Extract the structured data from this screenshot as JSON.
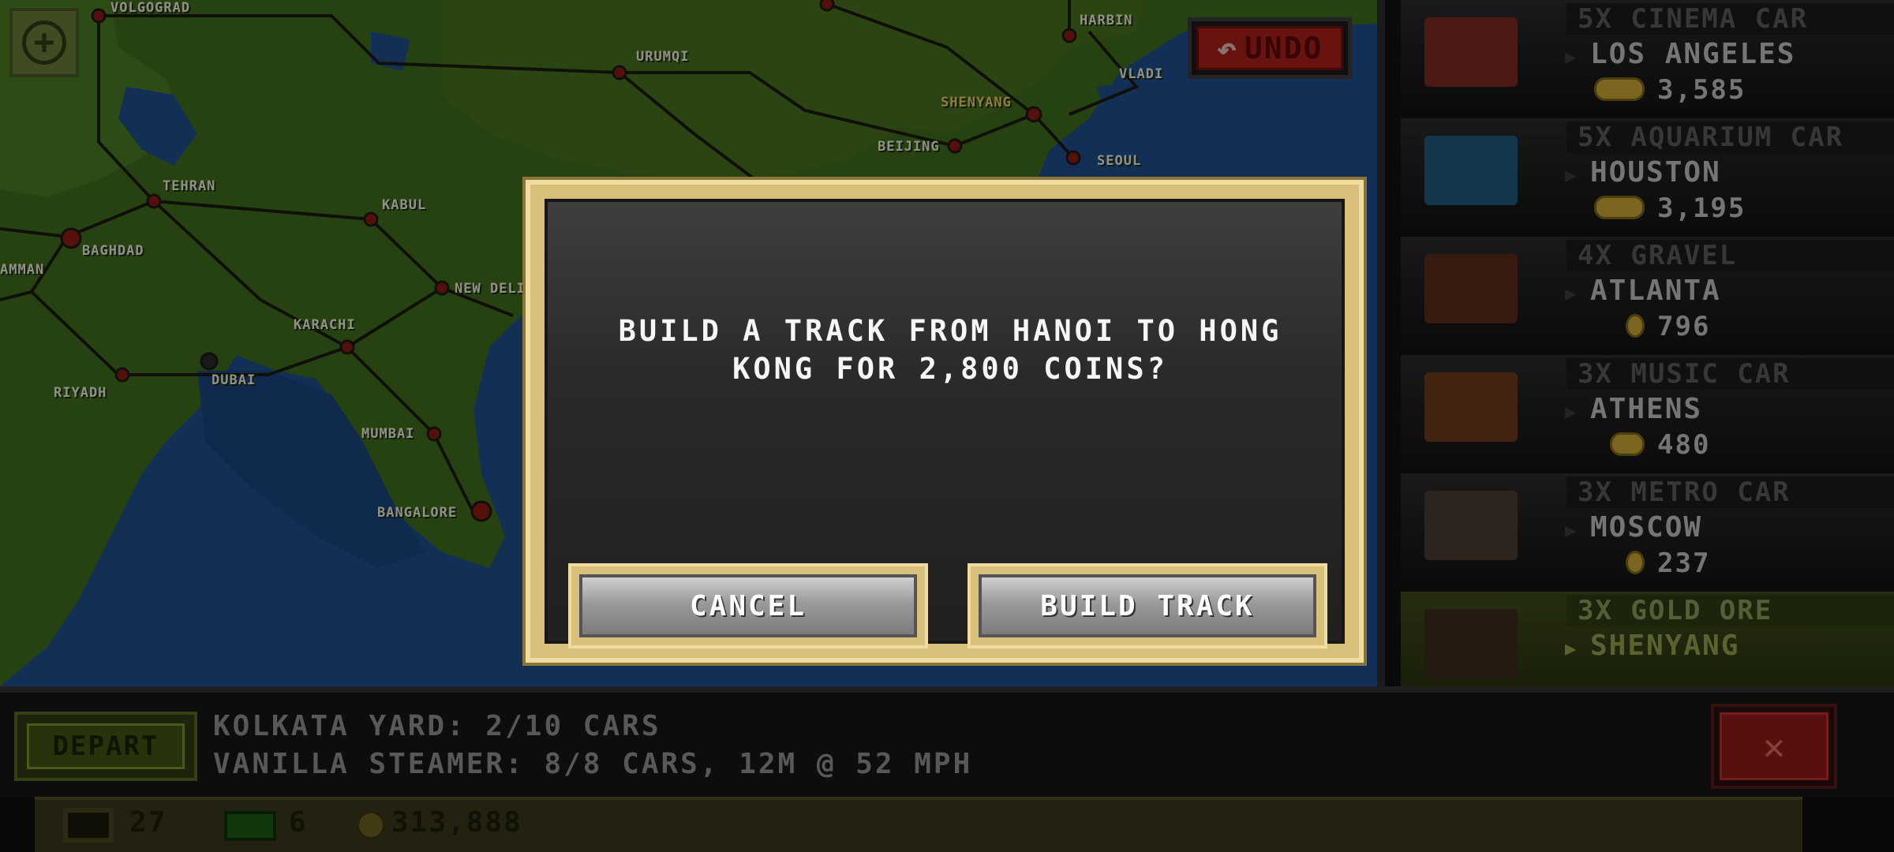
{
  "map": {
    "zoom_icon": "plus-in-circle-icon",
    "undo_label": "UNDO",
    "undo_icon": "curved-arrow-left-icon",
    "cities": [
      {
        "name": "VOLGOGRAD",
        "highlight": false
      },
      {
        "name": "HARBIN",
        "highlight": false
      },
      {
        "name": "URUMQI",
        "highlight": false
      },
      {
        "name": "VLADI",
        "highlight": false
      },
      {
        "name": "SHENYANG",
        "highlight": true
      },
      {
        "name": "BEIJING",
        "highlight": false
      },
      {
        "name": "SEOUL",
        "highlight": false
      },
      {
        "name": "TEHRAN",
        "highlight": false
      },
      {
        "name": "KABUL",
        "highlight": false
      },
      {
        "name": "BAGHDAD",
        "highlight": false
      },
      {
        "name": "AMMAN",
        "highlight": false
      },
      {
        "name": "NEW DELI",
        "highlight": false
      },
      {
        "name": "KARACHI",
        "highlight": false
      },
      {
        "name": "RIYADH",
        "highlight": false
      },
      {
        "name": "DUBAI",
        "highlight": false
      },
      {
        "name": "MUMBAI",
        "highlight": false
      },
      {
        "name": "BANGALORE",
        "highlight": false
      }
    ]
  },
  "route_list": [
    {
      "cargo": "5X CINEMA CAR",
      "destination": "LOS ANGELES",
      "payout": "3,585",
      "coin_icon": "coin-stack-icon",
      "thumb_color": "#7a2a22",
      "selected": false
    },
    {
      "cargo": "5X AQUARIUM CAR",
      "destination": "HOUSTON",
      "payout": "3,195",
      "coin_icon": "coin-stack-icon",
      "thumb_color": "#1f5a78",
      "selected": false
    },
    {
      "cargo": "4X GRAVEL",
      "destination": "ATLANTA",
      "payout": "796",
      "coin_icon": "coin-icon",
      "thumb_color": "#5a2a1a",
      "selected": false
    },
    {
      "cargo": "3X MUSIC CAR",
      "destination": "ATHENS",
      "payout": "480",
      "coin_icon": "coin-stack-icon",
      "thumb_color": "#6a3a1a",
      "selected": false
    },
    {
      "cargo": "3X METRO CAR",
      "destination": "MOSCOW",
      "payout": "237",
      "coin_icon": "coin-icon",
      "thumb_color": "#4a3a34",
      "selected": false
    },
    {
      "cargo": "3X GOLD ORE",
      "destination": "SHENYANG",
      "payout": "",
      "coin_icon": "coin-stack-icon",
      "thumb_color": "#3a2a1a",
      "selected": true
    }
  ],
  "bottom_bar": {
    "depart_label": "DEPART",
    "yard_info": "KOLKATA YARD: 2/10 CARS",
    "train_info": "VANILLA STEAMER: 8/8 CARS, 12M @ 52 MPH",
    "close_label": "✕"
  },
  "status_bar": {
    "depots": "27",
    "cash": "6",
    "coins": "313,888"
  },
  "dialog": {
    "message_line1": "BUILD A TRACK FROM HANOI TO HONG",
    "message_line2": "KONG FOR 2,800 COINS?",
    "cancel_label": "CANCEL",
    "confirm_label": "BUILD TRACK"
  },
  "colors": {
    "land": "#3f6b1c",
    "ocean": "#1d4d8a",
    "dialog_frame": "#d8bf7a",
    "undo_red": "#a8201a",
    "depart_green": "#3f5312"
  }
}
